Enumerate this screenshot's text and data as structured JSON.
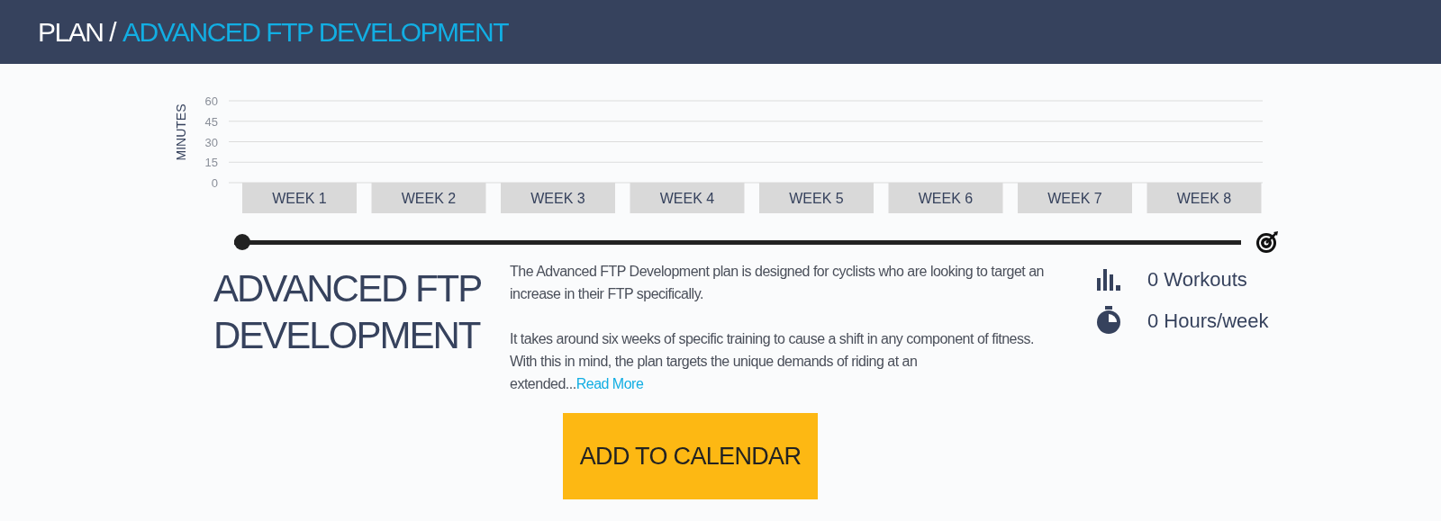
{
  "header": {
    "section": "PLAN /",
    "title": "ADVANCED FTP DEVELOPMENT"
  },
  "chart": {
    "chart_data": {
      "type": "bar",
      "ylabel": "MINUTES",
      "categories": [
        "WEEK 1",
        "WEEK 2",
        "WEEK 3",
        "WEEK 4",
        "WEEK 5",
        "WEEK 6",
        "WEEK 7",
        "WEEK 8"
      ],
      "values": [
        0,
        0,
        0,
        0,
        0,
        0,
        0,
        0
      ],
      "ylim": [
        0,
        60
      ],
      "yticks": [
        0,
        15,
        30,
        45,
        60
      ],
      "grid": true
    }
  },
  "plan": {
    "name": "ADVANCED FTP DEVELOPMENT",
    "description": [
      "The Advanced FTP Development plan is designed for cyclists who are looking to target an increase in their FTP specifically.",
      "It takes around six weeks of specific training to cause a shift in any component of fitness. With this in mind, the plan targets the unique demands of riding at an extended..."
    ],
    "read_more": "Read More",
    "stats": [
      {
        "kind": "workouts",
        "text": "0 Workouts"
      },
      {
        "kind": "hours",
        "text": "0 Hours/week"
      }
    ]
  },
  "add_button": "ADD TO CALENDAR"
}
